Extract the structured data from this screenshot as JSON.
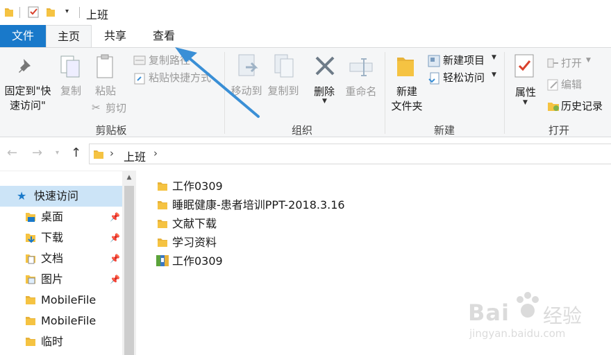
{
  "window": {
    "title": "上班"
  },
  "tabs": [
    {
      "label": "文件"
    },
    {
      "label": "主页"
    },
    {
      "label": "共享"
    },
    {
      "label": "查看"
    }
  ],
  "ribbon": {
    "clipboard": {
      "group_label": "剪贴板",
      "pin_quick_line1": "固定到\"快",
      "pin_quick_line2": "速访问\"",
      "copy": "复制",
      "paste": "粘贴",
      "copy_path": "复制路径",
      "paste_shortcut": "粘贴快捷方式",
      "cut": "剪切"
    },
    "organize": {
      "group_label": "组织",
      "move_to": "移动到",
      "copy_to": "复制到",
      "delete": "删除",
      "rename": "重命名"
    },
    "new": {
      "group_label": "新建",
      "new_folder_line1": "新建",
      "new_folder_line2": "文件夹",
      "new_item": "新建项目",
      "easy_access": "轻松访问"
    },
    "open": {
      "group_label": "打开",
      "properties": "属性",
      "open": "打开",
      "edit": "编辑",
      "history": "历史记录"
    }
  },
  "address": {
    "crumb": "上班"
  },
  "nav_pane": {
    "items": [
      {
        "label": "快速访问"
      },
      {
        "label": "桌面"
      },
      {
        "label": "下载"
      },
      {
        "label": "文档"
      },
      {
        "label": "图片"
      },
      {
        "label": "MobileFile"
      },
      {
        "label": "MobileFile"
      },
      {
        "label": "临时"
      }
    ]
  },
  "files": [
    {
      "name": "工作0309",
      "icon": "folder-icon"
    },
    {
      "name": "睡眠健康-患者培训PPT-2018.3.16",
      "icon": "folder-icon"
    },
    {
      "name": "文献下载",
      "icon": "folder-icon"
    },
    {
      "name": "学习资料",
      "icon": "folder-icon"
    },
    {
      "name": "工作0309",
      "icon": "archive-icon"
    }
  ],
  "watermark": {
    "brand_left": "Bai",
    "brand_right": "经验",
    "url": "jingyan.baidu.com"
  },
  "colors": {
    "accent": "#1979ca",
    "folder": "#f5c342",
    "selected": "#cce4f7",
    "arrow": "#3a8fd6"
  }
}
